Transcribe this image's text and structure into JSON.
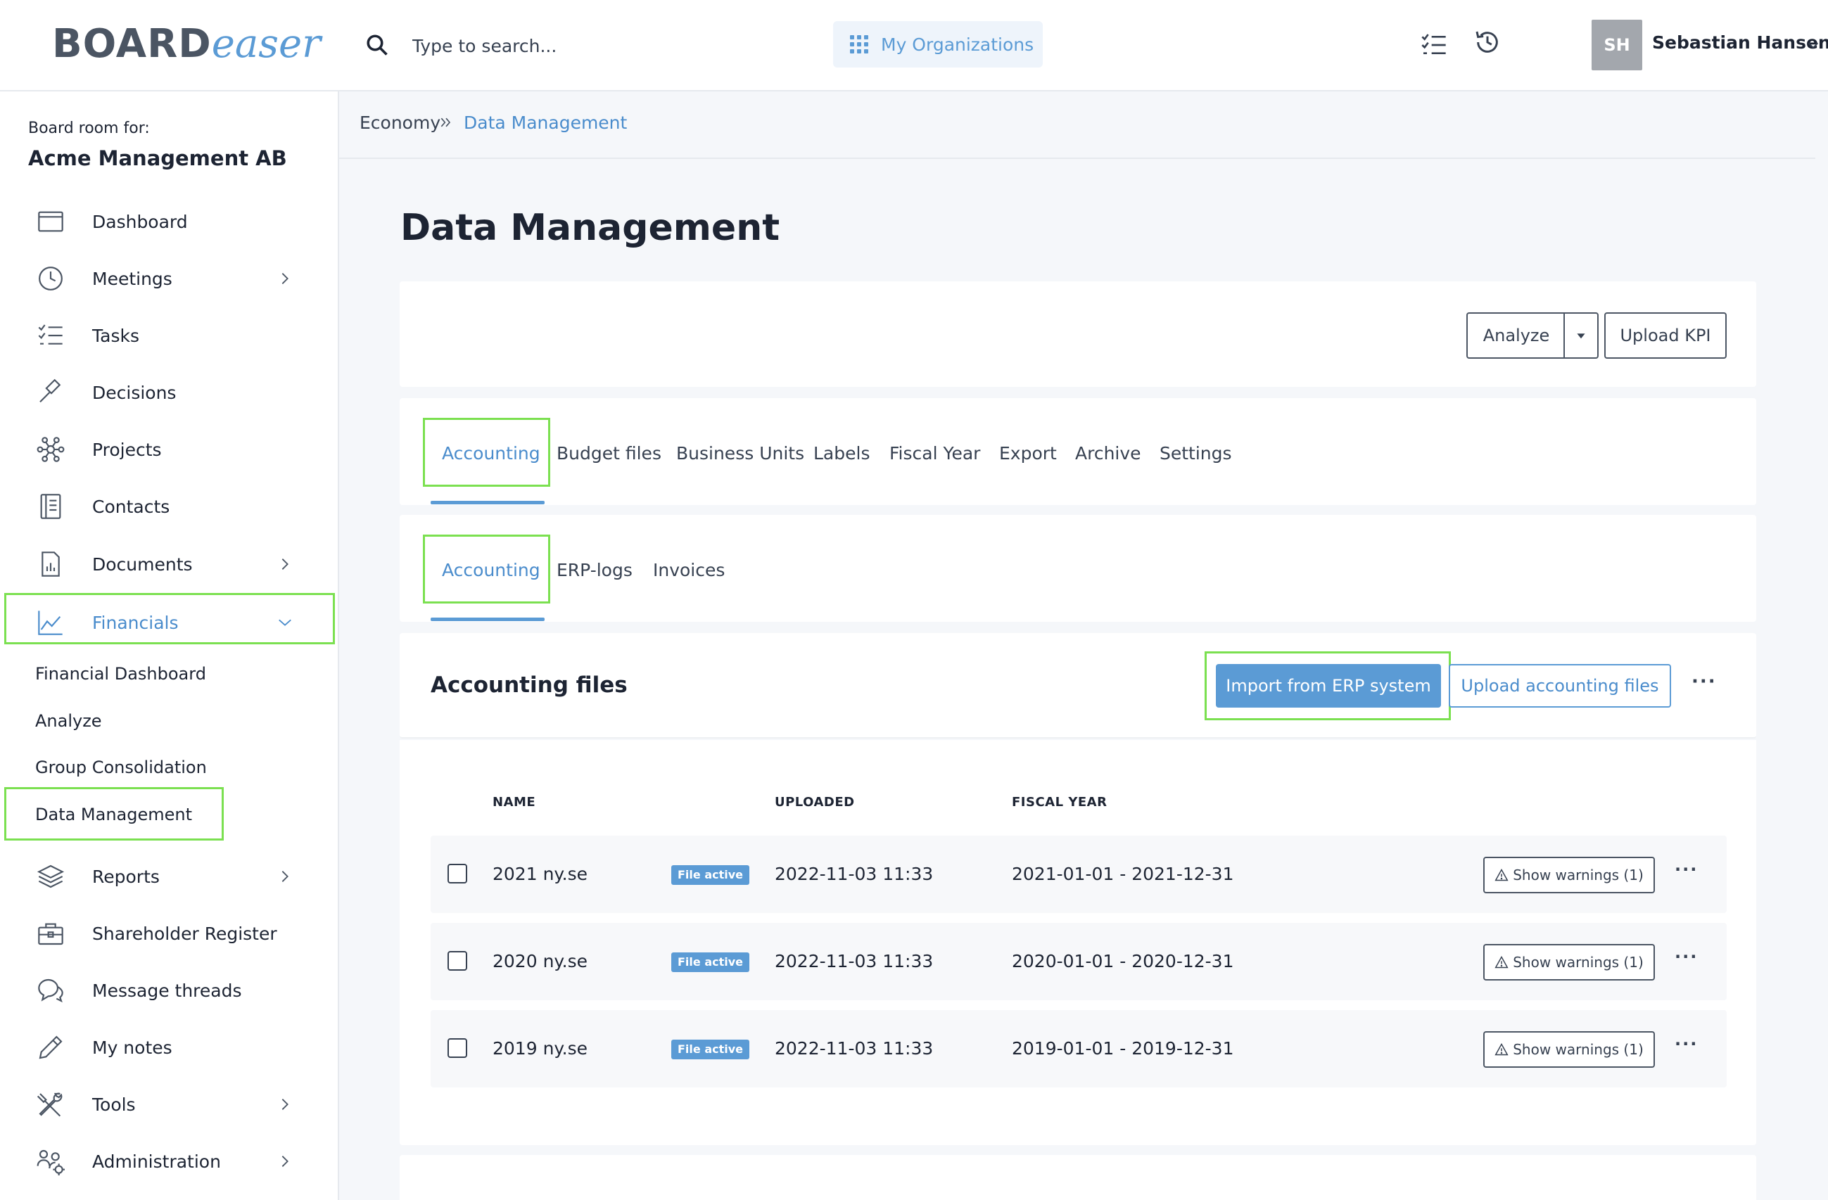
{
  "brand": {
    "logo_bold": "BOARD",
    "logo_script": "easer"
  },
  "topbar": {
    "search_placeholder": "Type to search...",
    "org_button": "My Organizations",
    "user_initials": "SH",
    "user_name": "Sebastian Hansen"
  },
  "sidebar": {
    "board_label": "Board room for:",
    "board_name": "Acme Management AB",
    "items": [
      {
        "label": "Dashboard",
        "icon": "calendar-icon"
      },
      {
        "label": "Meetings",
        "icon": "clock-icon"
      },
      {
        "label": "Tasks",
        "icon": "checklist-icon"
      },
      {
        "label": "Decisions",
        "icon": "gavel-icon"
      },
      {
        "label": "Projects",
        "icon": "network-icon"
      },
      {
        "label": "Contacts",
        "icon": "address-book-icon"
      },
      {
        "label": "Documents",
        "icon": "document-icon"
      },
      {
        "label": "Financials",
        "icon": "line-chart-icon"
      },
      {
        "label": "Reports",
        "icon": "layers-icon"
      },
      {
        "label": "Shareholder Register",
        "icon": "briefcase-icon"
      },
      {
        "label": "Message threads",
        "icon": "chat-icon"
      },
      {
        "label": "My notes",
        "icon": "pencil-icon"
      },
      {
        "label": "Tools",
        "icon": "tools-icon"
      },
      {
        "label": "Administration",
        "icon": "users-gear-icon"
      }
    ],
    "financials_sub": [
      "Financial Dashboard",
      "Analyze",
      "Group Consolidation",
      "Data Management"
    ]
  },
  "breadcrumb": {
    "parent": "Economy",
    "current": "Data Management"
  },
  "main": {
    "title": "Data Management",
    "actions": {
      "analyze": "Analyze",
      "upload_kpi": "Upload KPI"
    },
    "tabs": [
      "Accounting",
      "Budget files",
      "Business Units",
      "Labels",
      "Fiscal Year",
      "Export",
      "Archive",
      "Settings"
    ],
    "subtabs": [
      "Accounting",
      "ERP-logs",
      "Invoices"
    ],
    "section_title": "Accounting files",
    "import_button": "Import from ERP system",
    "upload_button": "Upload accounting files",
    "columns": {
      "name": "NAME",
      "uploaded": "UPLOADED",
      "fiscal_year": "FISCAL YEAR"
    },
    "rows": [
      {
        "name": "2021 ny.se",
        "status": "File active",
        "uploaded": "2022-11-03 11:33",
        "fiscal_year": "2021-01-01 - 2021-12-31",
        "warnings": "Show warnings (1)"
      },
      {
        "name": "2020 ny.se",
        "status": "File active",
        "uploaded": "2022-11-03 11:33",
        "fiscal_year": "2020-01-01 - 2020-12-31",
        "warnings": "Show warnings (1)"
      },
      {
        "name": "2019 ny.se",
        "status": "File active",
        "uploaded": "2022-11-03 11:33",
        "fiscal_year": "2019-01-01 - 2019-12-31",
        "warnings": "Show warnings (1)"
      }
    ]
  },
  "colors": {
    "accent": "#5b9bd5",
    "highlight": "#7be050",
    "text": "#1d2433"
  }
}
